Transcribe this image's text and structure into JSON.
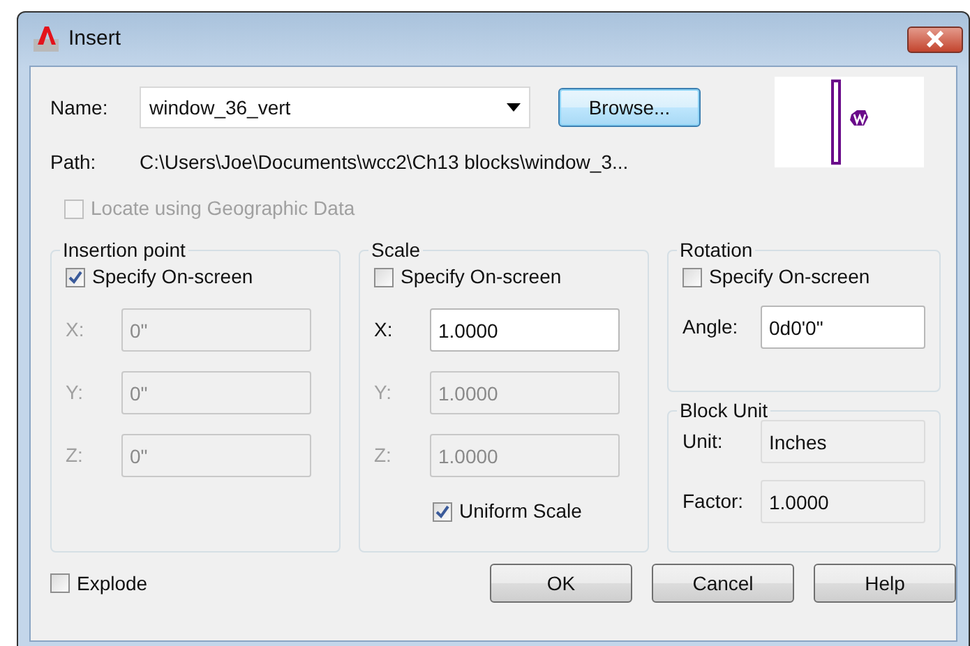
{
  "window": {
    "title": "Insert"
  },
  "name": {
    "label": "Name:",
    "value": "window_36_vert"
  },
  "browse_button": "Browse...",
  "path": {
    "label": "Path:",
    "value": "C:\\Users\\Joe\\Documents\\wcc2\\Ch13 blocks\\window_3..."
  },
  "locate": {
    "label": "Locate using Geographic Data",
    "checked": false,
    "disabled": true
  },
  "insertion_point": {
    "title": "Insertion point",
    "specify": {
      "label": "Specify On-screen",
      "checked": true,
      "disabled": false
    },
    "fields": [
      {
        "label": "X:",
        "value": "0\"",
        "disabled": true
      },
      {
        "label": "Y:",
        "value": "0\"",
        "disabled": true
      },
      {
        "label": "Z:",
        "value": "0\"",
        "disabled": true
      }
    ]
  },
  "scale": {
    "title": "Scale",
    "specify": {
      "label": "Specify On-screen",
      "checked": false,
      "disabled": false
    },
    "fields": [
      {
        "label": "X:",
        "value": "1.0000",
        "disabled": false
      },
      {
        "label": "Y:",
        "value": "1.0000",
        "disabled": true
      },
      {
        "label": "Z:",
        "value": "1.0000",
        "disabled": true
      }
    ],
    "uniform": {
      "label": "Uniform Scale",
      "checked": true,
      "disabled": false
    }
  },
  "rotation": {
    "title": "Rotation",
    "specify": {
      "label": "Specify On-screen",
      "checked": false,
      "disabled": false
    },
    "fields": [
      {
        "label": "Angle:",
        "value": "0d0'0\"",
        "disabled": false
      }
    ]
  },
  "block_unit": {
    "title": "Block Unit",
    "fields": [
      {
        "label": "Unit:",
        "value": "Inches",
        "disabled": true
      },
      {
        "label": "Factor:",
        "value": "1.0000",
        "disabled": true
      }
    ]
  },
  "explode": {
    "label": "Explode",
    "checked": false,
    "disabled": false
  },
  "buttons": [
    "OK",
    "Cancel",
    "Help"
  ]
}
